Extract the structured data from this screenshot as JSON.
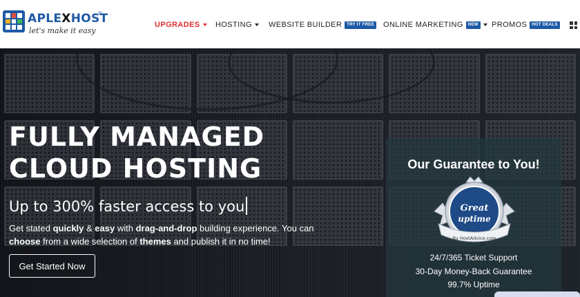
{
  "logo": {
    "name_part1": "APLE",
    "name_x": "X",
    "name_part2": "HOST",
    "registered": "®",
    "tagline": "let's make it easy"
  },
  "nav": {
    "items": [
      {
        "label": "UPGRADES",
        "badge": ""
      },
      {
        "label": "HOSTING",
        "badge": ""
      },
      {
        "label": "WEBSITE BUILDER",
        "badge": "TRY IT FREE"
      },
      {
        "label": "ONLINE MARKETING",
        "badge": "NEW"
      },
      {
        "label": "PROMOS",
        "badge": "HOT DEALS"
      }
    ],
    "active_color": "#e02d2d",
    "badge_color": "#1f5aa6"
  },
  "hero": {
    "headline1": "FULLY MANAGED",
    "headline2": "CLOUD HOSTING",
    "subheadline": "Up to 300% faster access to you",
    "description": {
      "t1": "Get stated ",
      "b1": "quickly",
      "t2": " & ",
      "b2": "easy",
      "t3": " with ",
      "b3": "drag-and-drop",
      "t4": " building experience. You can ",
      "b4": "choose",
      "t5": " from a wide selection of ",
      "b5": "themes",
      "t6": " and publish it in no time!"
    },
    "cta_label": "Get Started Now"
  },
  "guarantee": {
    "title": "Our Guarantee to You!",
    "seal_line1": "Great",
    "seal_line2": "uptime",
    "seal_credit": "By HostAdvice.com",
    "items": [
      "24/7/365 Ticket Support",
      "30-Day Money-Back Guarantee",
      "99.7% Uptime"
    ]
  }
}
